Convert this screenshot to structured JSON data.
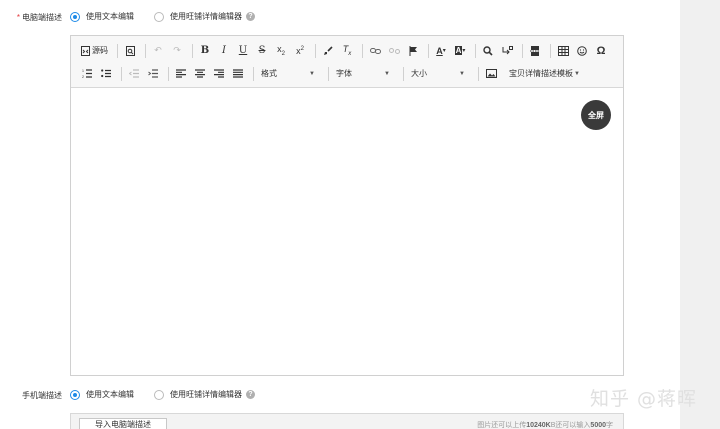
{
  "desktop_section": {
    "required_mark": "*",
    "label": "电脑端描述",
    "option_text_editor": "使用文本编辑",
    "option_wangpu_editor": "使用旺铺详情编辑器",
    "selected": "text"
  },
  "toolbar": {
    "source_label": "源码",
    "format_label": "格式",
    "font_label": "字体",
    "size_label": "大小",
    "template_label": "宝贝详情描述模板"
  },
  "editor": {
    "fullscreen_label": "全屏",
    "content": ""
  },
  "mobile_section": {
    "label": "手机端描述",
    "option_text_editor": "使用文本编辑",
    "option_wangpu_editor": "使用旺铺详情编辑器",
    "selected": "text"
  },
  "mobile_bar": {
    "import_button": "导入电脑端描述",
    "hint_prefix": "图片还可以上传",
    "hint_image_size": "10240K",
    "hint_middle": "B还可以输入",
    "hint_chars": "5000",
    "hint_suffix": "字"
  },
  "watermark": "知乎 @蒋晖",
  "colors": {
    "accent": "#1e8ae7",
    "required": "#e4393c",
    "fullscreen_bg": "#3a3a3a"
  }
}
